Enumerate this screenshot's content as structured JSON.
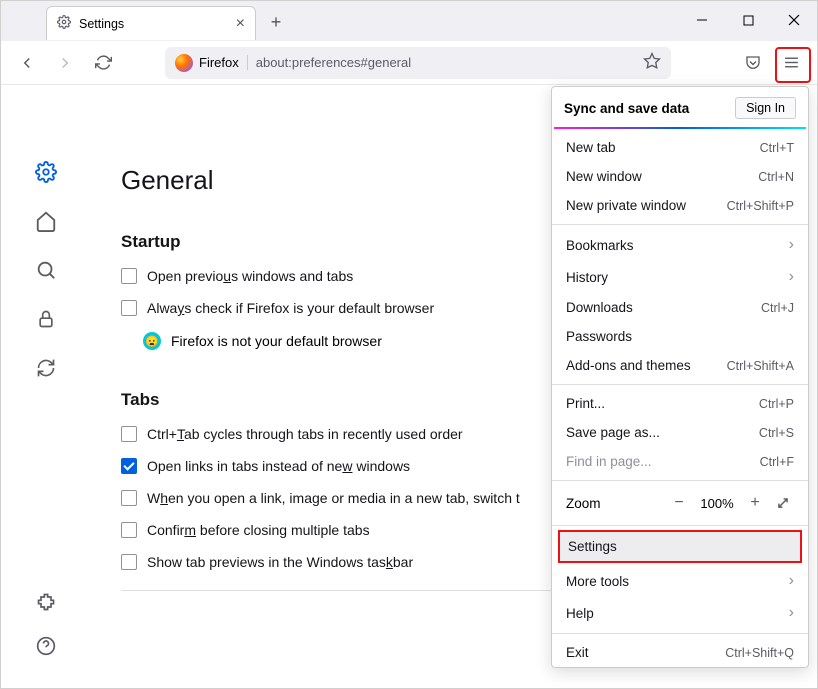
{
  "tab": {
    "title": "Settings"
  },
  "address": {
    "identity": "Firefox",
    "url": "about:preferences#general"
  },
  "page": {
    "title": "General",
    "startup": {
      "heading": "Startup",
      "open_previous": "Open previous windows and tabs",
      "always_check": "Always check if Firefox is your default browser",
      "not_default": "Firefox is not your default browser"
    },
    "tabs": {
      "heading": "Tabs",
      "ctrl_tab": "Ctrl+Tab cycles through tabs in recently used order",
      "open_links": "Open links in tabs instead of new windows",
      "switch_to": "When you open a link, image or media in a new tab, switch t",
      "confirm_close": "Confirm before closing multiple tabs",
      "taskbar_preview": "Show tab previews in the Windows taskbar"
    }
  },
  "menu": {
    "sync_title": "Sync and save data",
    "sign_in": "Sign In",
    "new_tab": {
      "label": "New tab",
      "shortcut": "Ctrl+T"
    },
    "new_window": {
      "label": "New window",
      "shortcut": "Ctrl+N"
    },
    "new_private": {
      "label": "New private window",
      "shortcut": "Ctrl+Shift+P"
    },
    "bookmarks": {
      "label": "Bookmarks"
    },
    "history": {
      "label": "History"
    },
    "downloads": {
      "label": "Downloads",
      "shortcut": "Ctrl+J"
    },
    "passwords": {
      "label": "Passwords"
    },
    "addons": {
      "label": "Add-ons and themes",
      "shortcut": "Ctrl+Shift+A"
    },
    "print": {
      "label": "Print...",
      "shortcut": "Ctrl+P"
    },
    "save_page": {
      "label": "Save page as...",
      "shortcut": "Ctrl+S"
    },
    "find": {
      "label": "Find in page...",
      "shortcut": "Ctrl+F"
    },
    "zoom": {
      "label": "Zoom",
      "value": "100%"
    },
    "settings": {
      "label": "Settings"
    },
    "more_tools": {
      "label": "More tools"
    },
    "help": {
      "label": "Help"
    },
    "exit": {
      "label": "Exit",
      "shortcut": "Ctrl+Shift+Q"
    }
  }
}
